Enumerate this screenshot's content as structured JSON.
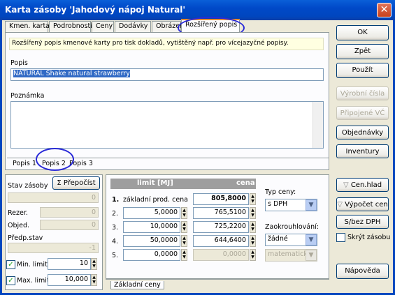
{
  "window": {
    "title": "Karta zásoby 'Jahodový nápoj Natural'",
    "close": "✕"
  },
  "tabs": [
    "Kmen. karta",
    "Podrobnosti",
    "Ceny",
    "Dodávky",
    "Obrázek",
    "Rozšířený popis"
  ],
  "note": "Rozšířený popis kmenové karty pro tisk dokladů, vytištěný např. pro vícejazyčné popisy.",
  "popis": {
    "label": "Popis",
    "value": "NATURAL Shake natural strawberry"
  },
  "poznamka": {
    "label": "Poznámka"
  },
  "subtabs": [
    "Popis 1",
    "Popis 2",
    "Popis 3"
  ],
  "right_buttons": {
    "ok": "OK",
    "zpet": "Zpět",
    "pouzit": "Použít",
    "vyrobni": "Výrobní čísla",
    "pripojene": "Připojené VČ",
    "objednavky": "Objednávky",
    "inventury": "Inventury",
    "cen_hlad": "Cen.hlad",
    "vypocet": "Výpočet cen",
    "sbez": "S/bez DPH",
    "skryt": "Skrýt zásobu",
    "napoveda": "Nápověda"
  },
  "stock": {
    "stav_label": "Stav zásoby",
    "prepocist": "Přepočíst",
    "stav_value": "0",
    "rezer_label": "Rezer.",
    "rezer_value": "0",
    "objed_label": "Objed.",
    "objed_value": "0",
    "predp_label": "Předp.stav",
    "predp_value": "-1",
    "min_label": "Min. limit:",
    "min_value": "10",
    "max_label": "Max. limit:",
    "max_value": "10,000"
  },
  "prices": {
    "hdr_limit": "limit [MJ]",
    "hdr_cena": "cena",
    "rows": [
      {
        "n": "1.",
        "limit": "základní prod. cena",
        "cena": "805,8000"
      },
      {
        "n": "2.",
        "limit": "5,0000",
        "cena": "765,5100"
      },
      {
        "n": "3.",
        "limit": "10,0000",
        "cena": "725,2200"
      },
      {
        "n": "4.",
        "limit": "50,0000",
        "cena": "644,6400"
      },
      {
        "n": "5.",
        "limit": "0,0000",
        "cena": "0,0000"
      }
    ],
    "typ_label": "Typ ceny:",
    "typ_value": "s DPH",
    "zaok_label": "Zaokrouhlování:",
    "zaok_value": "žádné",
    "zaok2_value": "matematický",
    "tab": "Základní ceny"
  }
}
